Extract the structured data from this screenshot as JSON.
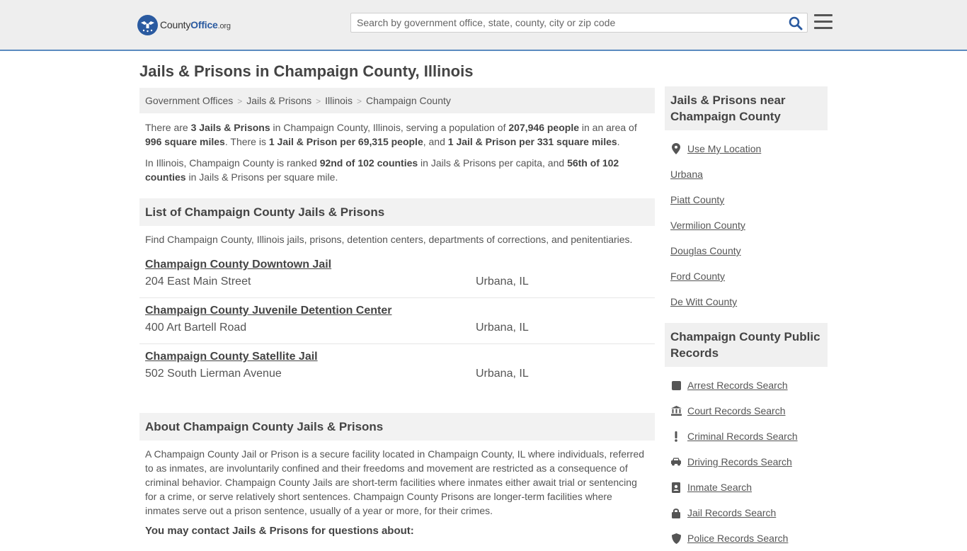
{
  "header": {
    "logo_county": "County",
    "logo_office": "Office",
    "logo_org": ".org",
    "search_placeholder": "Search by government office, state, county, city or zip code"
  },
  "page_title": "Jails & Prisons in Champaign County, Illinois",
  "breadcrumb": [
    "Government Offices",
    "Jails & Prisons",
    "Illinois",
    "Champaign County"
  ],
  "intro": {
    "p1": [
      {
        "t": "There are ",
        "b": false
      },
      {
        "t": "3 Jails & Prisons",
        "b": true
      },
      {
        "t": " in Champaign County, Illinois, serving a population of ",
        "b": false
      },
      {
        "t": "207,946 people",
        "b": true
      },
      {
        "t": " in an area of ",
        "b": false
      },
      {
        "t": "996 square miles",
        "b": true
      },
      {
        "t": ". There is ",
        "b": false
      },
      {
        "t": "1 Jail & Prison per 69,315 people",
        "b": true
      },
      {
        "t": ", and ",
        "b": false
      },
      {
        "t": "1 Jail & Prison per 331 square miles",
        "b": true
      },
      {
        "t": ".",
        "b": false
      }
    ],
    "p2": [
      {
        "t": "In Illinois, Champaign County is ranked ",
        "b": false
      },
      {
        "t": "92nd of 102 counties",
        "b": true
      },
      {
        "t": " in Jails & Prisons per capita, and ",
        "b": false
      },
      {
        "t": "56th of 102 counties",
        "b": true
      },
      {
        "t": " in Jails & Prisons per square mile.",
        "b": false
      }
    ]
  },
  "list": {
    "heading": "List of Champaign County Jails & Prisons",
    "description": "Find Champaign County, Illinois jails, prisons, detention centers, departments of corrections, and penitentiaries.",
    "entries": [
      {
        "name": "Champaign County Downtown Jail",
        "address": "204 East Main Street",
        "city": "Urbana, IL"
      },
      {
        "name": "Champaign County Juvenile Detention Center",
        "address": "400 Art Bartell Road",
        "city": "Urbana, IL"
      },
      {
        "name": "Champaign County Satellite Jail",
        "address": "502 South Lierman Avenue",
        "city": "Urbana, IL"
      }
    ]
  },
  "about": {
    "heading": "About Champaign County Jails & Prisons",
    "text": "A Champaign County Jail or Prison is a secure facility located in Champaign County, IL where individuals, referred to as inmates, are involuntarily confined and their freedoms and movement are restricted as a consequence of criminal behavior. Champaign County Jails are short-term facilities where inmates either await trial or sentencing for a crime, or serve relatively short sentences. Champaign County Prisons are longer-term facilities where inmates serve out a prison sentence, usually of a year or more, for their crimes.",
    "contact": "You may contact Jails & Prisons for questions about:"
  },
  "sidebar": {
    "nearby_heading": "Jails & Prisons near Champaign County",
    "nearby": [
      {
        "label": "Use My Location",
        "icon": "location-pin-icon"
      },
      {
        "label": "Urbana"
      },
      {
        "label": "Piatt County"
      },
      {
        "label": "Vermilion County"
      },
      {
        "label": "Douglas County"
      },
      {
        "label": "Ford County"
      },
      {
        "label": "De Witt County"
      }
    ],
    "records_heading": "Champaign County Public Records",
    "records": [
      {
        "label": "Arrest Records Search",
        "icon": "square-icon"
      },
      {
        "label": "Court Records Search",
        "icon": "courthouse-icon"
      },
      {
        "label": "Criminal Records Search",
        "icon": "exclamation-icon"
      },
      {
        "label": "Driving Records Search",
        "icon": "car-icon"
      },
      {
        "label": "Inmate Search",
        "icon": "id-badge-icon"
      },
      {
        "label": "Jail Records Search",
        "icon": "lock-icon"
      },
      {
        "label": "Police Records Search",
        "icon": "shield-icon"
      }
    ]
  },
  "colors": {
    "brand_blue": "#2a5aa0",
    "header_bg": "#eeeeee",
    "header_border": "#5b8bc0",
    "panel_bg": "#f0f0f0"
  }
}
